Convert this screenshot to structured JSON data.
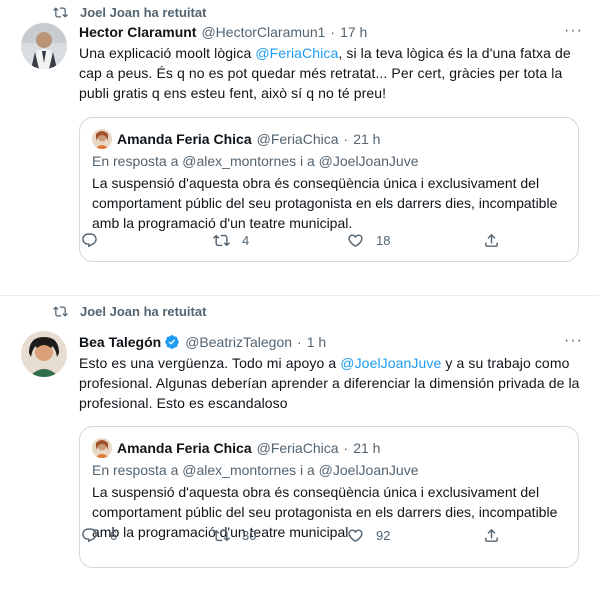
{
  "tweets": [
    {
      "retweeted_by": "Joel Joan ha retuitat",
      "author_name": "Hector Claramunt",
      "author_handle": "@HectorClaramun1",
      "time": "17 h",
      "text_before": "Una explicació moolt lògica ",
      "mention": "@FeriaChica",
      "text_after": ", si la teva lògica és la d'una fatxa de cap a peus. És q no es pot quedar més retratat... Per cert, gràcies per tota la publi gratis q ens esteu fent, això sí q no té preu!",
      "quote": {
        "author_name": "Amanda Feria Chica",
        "author_handle": "@FeriaChica",
        "time": "21 h",
        "reply_to": "En resposta a @alex_montornes i a @JoelJoanJuve",
        "text": "La suspensió d'aquesta obra és conseqüència única i exclusivament del comportament públic del seu protagonista en els darrers dies, incompatible amb la programació d'un teatre municipal."
      },
      "replies": "",
      "retweets": "4",
      "likes": "18"
    },
    {
      "retweeted_by": "Joel Joan ha retuitat",
      "author_name": "Bea Talegón",
      "author_handle": "@BeatrizTalegon",
      "time": "1 h",
      "text_before": "Esto es una vergüenza. Todo mi apoyo a ",
      "mention": "@JoelJoanJuve",
      "text_after": " y a su trabajo como profesional. Algunas deberían aprender a diferenciar la dimensión privada de la profesional. Esto es escandaloso",
      "quote": {
        "author_name": "Amanda Feria Chica",
        "author_handle": "@FeriaChica",
        "time": "21 h",
        "reply_to": "En resposta a @alex_montornes i a @JoelJoanJuve",
        "text": "La suspensió d'aquesta obra és conseqüència única i exclusivament del comportament públic del seu protagonista en els darrers dies, incompatible amb la programació d'un teatre municipal."
      },
      "replies": "6",
      "retweets": "30",
      "likes": "92"
    }
  ],
  "colors": {
    "link": "#1d9bf0",
    "muted": "#536471",
    "verified": "#1d9bf0",
    "border": "#cfd9de"
  },
  "icons": [
    "retweet-icon",
    "reply-icon",
    "like-icon",
    "share-icon",
    "verified-icon",
    "more-icon"
  ]
}
